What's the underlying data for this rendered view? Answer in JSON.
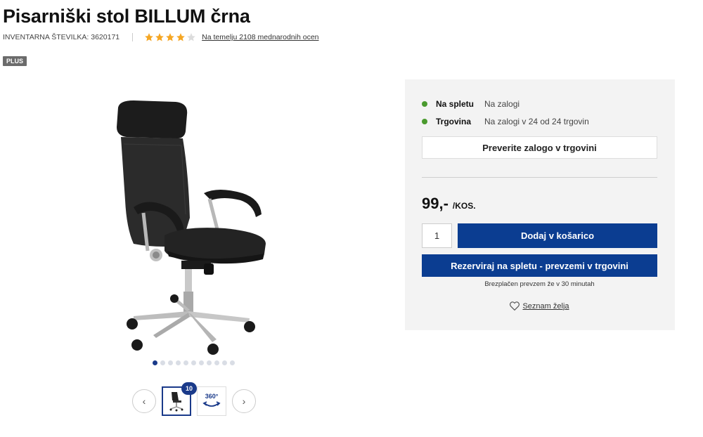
{
  "product": {
    "title": "Pisarniški stol BILLUM črna",
    "inventory_label": "INVENTARNA ŠTEVILKA: 3620171",
    "rating_value": 4,
    "rating_max": 5,
    "rating_link": "Na temelju 2108 mednarodnih ocen",
    "badge": "PLUS"
  },
  "gallery": {
    "image_icon": "office-chair-image",
    "dot_count": 11,
    "active_dot": 0,
    "thumb_count_badge": "10",
    "view360_label": "360°"
  },
  "availability": {
    "items": [
      {
        "label": "Na spletu",
        "value": "Na zalogi",
        "status_color": "#4a9a2e"
      },
      {
        "label": "Trgovina",
        "value": "Na zalogi v 24 od 24 trgovin",
        "status_color": "#4a9a2e"
      }
    ],
    "check_stock_label": "Preverite zalogo v trgovini"
  },
  "purchase": {
    "price": "99,-",
    "unit": "/KOS.",
    "quantity": "1",
    "add_to_cart_label": "Dodaj v košarico",
    "reserve_label": "Rezerviraj na spletu - prevzemi v trgovini",
    "pickup_note": "Brezplačen prevzem že v 30 minutah",
    "wishlist_label": "Seznam želja"
  },
  "colors": {
    "primary": "#0b3d91",
    "in_stock": "#4a9a2e",
    "star": "#f5a623"
  }
}
